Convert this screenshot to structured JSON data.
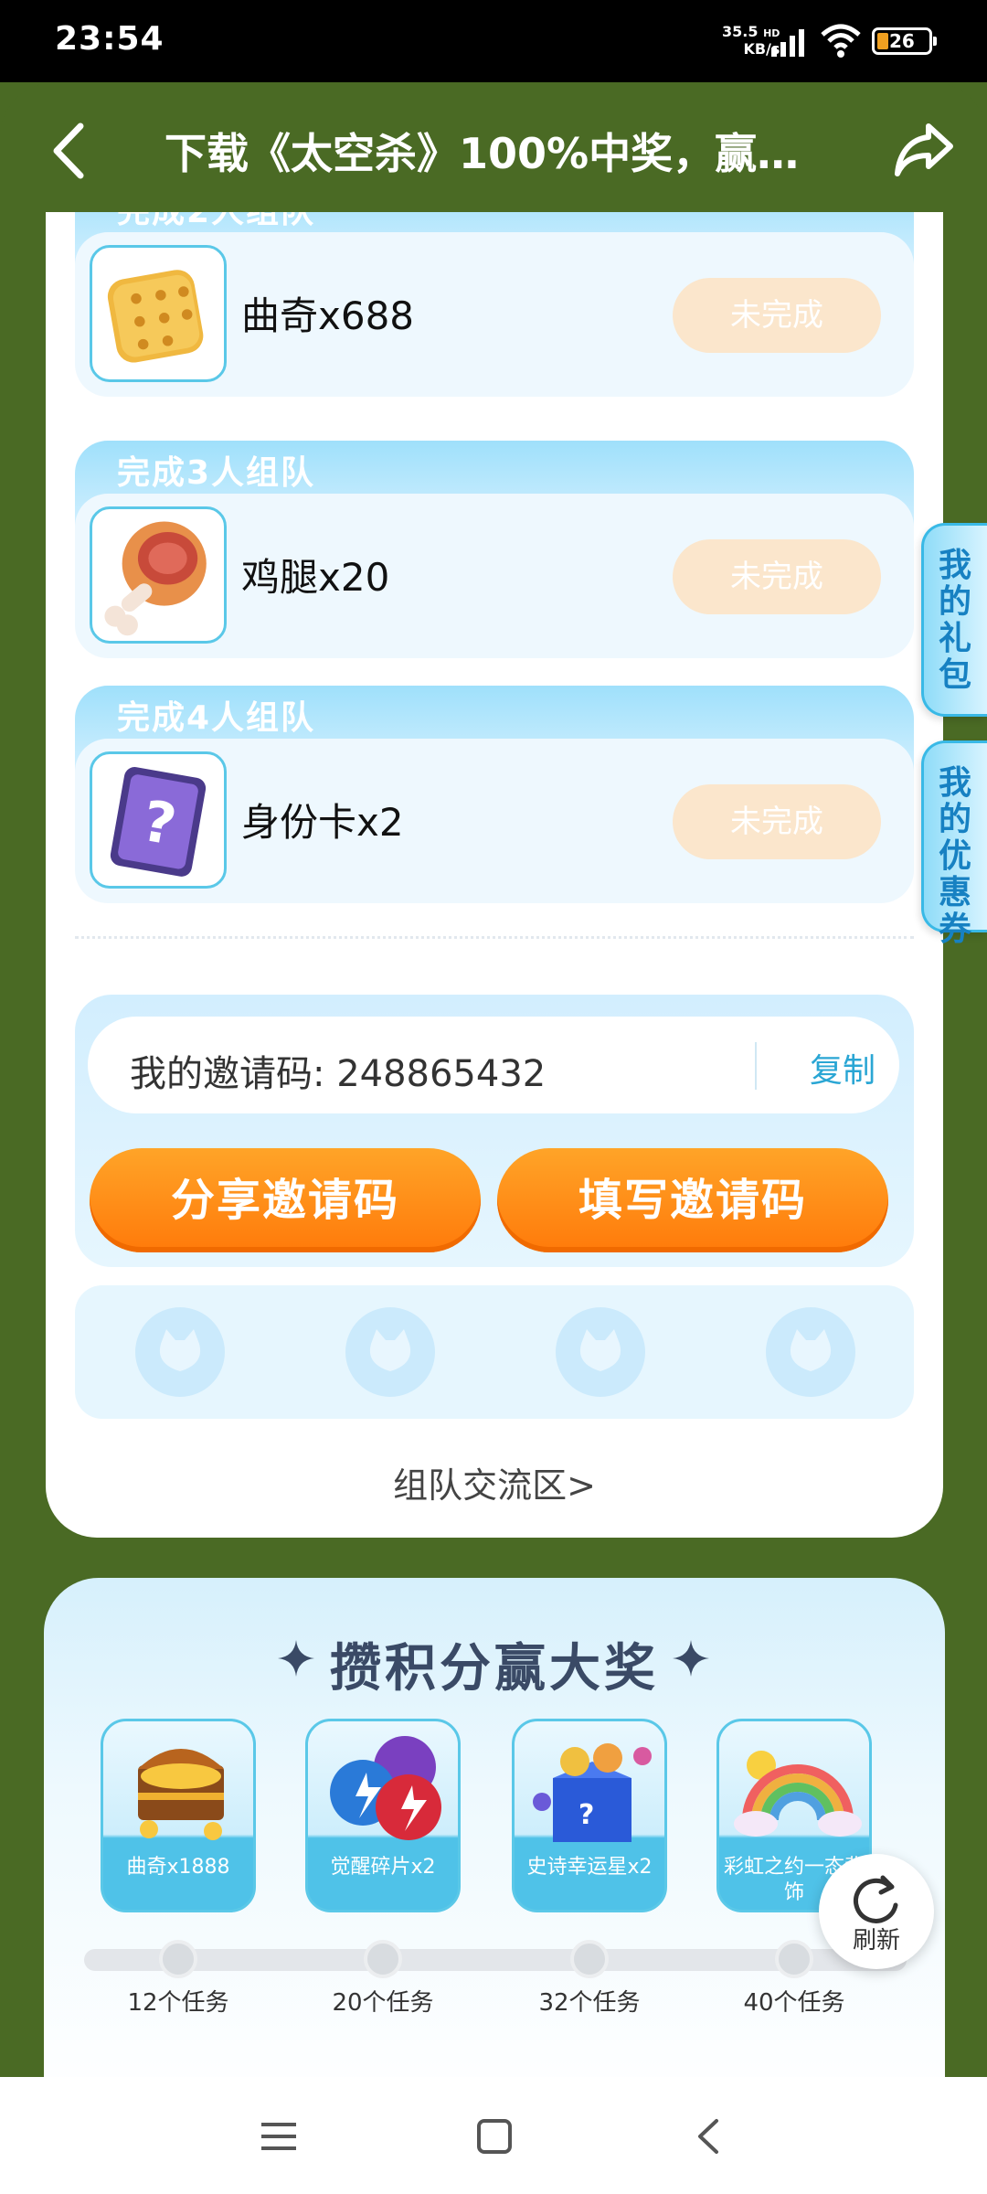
{
  "status_bar": {
    "time": "23:54",
    "net_speed_value": "35.5",
    "net_speed_unit": "KB/s",
    "net_type": "HD",
    "battery": "26"
  },
  "header": {
    "title": "下载《太空杀》100%中奖，赢赛..."
  },
  "team_rewards": [
    {
      "title": "完成2人组队",
      "item": "曲奇x688",
      "status": "未完成",
      "icon": "cookie-icon"
    },
    {
      "title": "完成3人组队",
      "item": "鸡腿x20",
      "status": "未完成",
      "icon": "drumstick-icon"
    },
    {
      "title": "完成4人组队",
      "item": "身份卡x2",
      "status": "未完成",
      "icon": "identity-card-icon"
    }
  ],
  "invite": {
    "code_label": "我的邀请码: 248865432",
    "copy_label": "复制",
    "share_button": "分享邀请码",
    "fill_button": "填写邀请码"
  },
  "team_link": "组队交流区>",
  "side_tabs": {
    "gift": "我的礼包",
    "coupon": "我的优惠券"
  },
  "panel": {
    "title": "攒积分赢大奖",
    "milestones": [
      {
        "label": "曲奇x1888",
        "tasks": "12个任务",
        "icon": "treasure-chest-icon"
      },
      {
        "label": "觉醒碎片x2",
        "tasks": "20个任务",
        "icon": "awakening-shard-icon"
      },
      {
        "label": "史诗幸运星x2",
        "tasks": "32个任务",
        "icon": "lucky-box-icon"
      },
      {
        "label": "彩虹之约一态背饰",
        "tasks": "40个任务",
        "icon": "rainbow-icon"
      }
    ],
    "refresh_label": "刷新"
  },
  "colors": {
    "page_bg": "#4a6a24",
    "accent_orange": "#ff8a14",
    "accent_blue": "#2aa6d4"
  }
}
